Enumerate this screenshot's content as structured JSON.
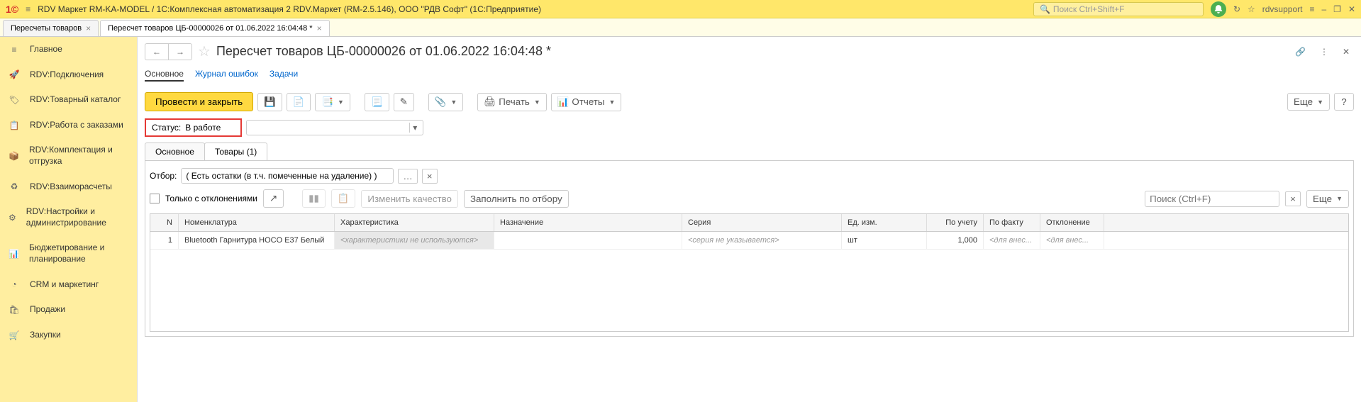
{
  "titlebar": {
    "app_title": "RDV Маркет RM-KA-MODEL / 1С:Комплексная автоматизация 2 RDV.Маркет (RM-2.5.146), ООО \"РДВ Софт\"  (1С:Предприятие)",
    "search_placeholder": "Поиск Ctrl+Shift+F",
    "user": "rdvsupport"
  },
  "tabs": [
    {
      "label": "Пересчеты товаров"
    },
    {
      "label": "Пересчет товаров ЦБ-00000026 от 01.06.2022 16:04:48 *"
    }
  ],
  "sidebar": [
    {
      "label": "Главное"
    },
    {
      "label": "RDV:Подключения"
    },
    {
      "label": "RDV:Товарный каталог"
    },
    {
      "label": "RDV:Работа с заказами"
    },
    {
      "label": "RDV:Комплектация и отгрузка"
    },
    {
      "label": "RDV:Взаиморасчеты"
    },
    {
      "label": "RDV:Настройки и администрирование"
    },
    {
      "label": "Бюджетирование и планирование"
    },
    {
      "label": "CRM и маркетинг"
    },
    {
      "label": "Продажи"
    },
    {
      "label": "Закупки"
    }
  ],
  "doc": {
    "title": "Пересчет товаров ЦБ-00000026 от 01.06.2022 16:04:48 *",
    "subtabs": {
      "main": "Основное",
      "errors": "Журнал ошибок",
      "tasks": "Задачи"
    },
    "toolbar": {
      "post_close": "Провести и закрыть",
      "print": "Печать",
      "reports": "Отчеты",
      "more": "Еще"
    },
    "status_label": "Статус:",
    "status_value": "В работе",
    "inner_tabs": {
      "main": "Основное",
      "goods": "Товары (1)"
    },
    "filter_label": "Отбор:",
    "filter_value": "( Есть остатки (в т.ч. помеченные на удаление) )",
    "only_deviations": "Только с отклонениями",
    "change_quality": "Изменить качество",
    "fill_by_filter": "Заполнить по отбору",
    "search_placeholder": "Поиск (Ctrl+F)",
    "more2": "Еще",
    "columns": {
      "n": "N",
      "nom": "Номенклатура",
      "char": "Характеристика",
      "naz": "Назначение",
      "ser": "Серия",
      "ed": "Ед. изм.",
      "uch": "По учету",
      "fact": "По факту",
      "otk": "Отклонение"
    },
    "rows": [
      {
        "n": "1",
        "nom": "Bluetooth Гарнитура HOCO E37 Белый",
        "char": "<характеристики не используются>",
        "ser": "<серия не указывается>",
        "ed": "шт",
        "uch": "1,000",
        "fact": "<для внес...",
        "otk": "<для внес..."
      }
    ]
  }
}
